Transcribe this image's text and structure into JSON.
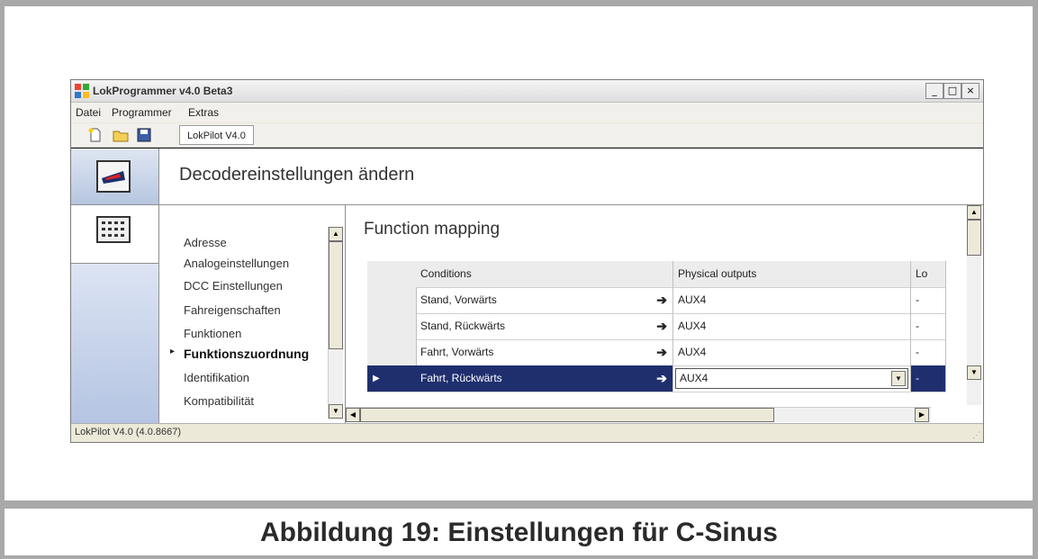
{
  "window": {
    "title": "LokProgrammer v4.0 Beta3",
    "controls": {
      "minimize": "_",
      "maximize": "□",
      "close": "×"
    }
  },
  "menubar": {
    "items": [
      "Datei",
      "Programmer",
      "Extras"
    ]
  },
  "toolbar": {
    "icons": [
      "new-file-icon",
      "open-folder-icon",
      "save-icon"
    ],
    "tab_label": "LokPilot V4.0"
  },
  "header": {
    "title": "Decodereinstellungen ändern"
  },
  "nav": {
    "items": [
      "Adresse",
      "Analogeinstellungen",
      "DCC Einstellungen",
      "Fahreigenschaften",
      "Funktionen",
      "Funktionszuordnung",
      "Identifikation",
      "Kompatibilität"
    ],
    "active_item": "Funktionszuordnung"
  },
  "main": {
    "title": "Function mapping",
    "columns": [
      "Conditions",
      "Physical outputs",
      "Lo"
    ],
    "rows": [
      {
        "condition": "Stand, Vorwärts",
        "output": "AUX4",
        "lo": "-"
      },
      {
        "condition": "Stand, Rückwärts",
        "output": "AUX4",
        "lo": "-"
      },
      {
        "condition": "Fahrt, Vorwärts",
        "output": "AUX4",
        "lo": "-"
      },
      {
        "condition": "Fahrt, Rückwärts",
        "output": "AUX4",
        "lo": "-"
      }
    ],
    "selected_row": 3
  },
  "status": {
    "text": "LokPilot V4.0 (4.0.8667)"
  },
  "caption": "Abbildung 19: Einstellungen für C-Sinus",
  "colors": {
    "selection": "#1f2f6e",
    "frame": "#a9a9a9"
  }
}
